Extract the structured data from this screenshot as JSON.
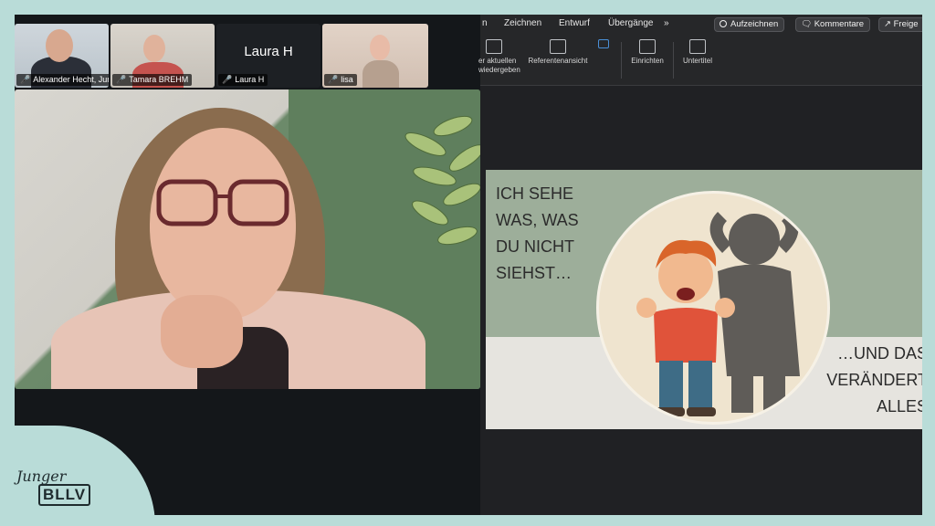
{
  "participants": [
    {
      "name": "Alexander Hecht, Jun..."
    },
    {
      "name": "Tamara BREHM"
    },
    {
      "name": "Laura H",
      "big_name": "Laura H"
    },
    {
      "name": "lisa"
    }
  ],
  "ppt": {
    "tabs": [
      "n",
      "Zeichnen",
      "Entwurf",
      "Übergänge",
      "»"
    ],
    "buttons": {
      "record": "Aufzeichnen",
      "comments": "Kommentare",
      "share": "Freige"
    },
    "ribbon": {
      "from_current_line1": "er aktuellen",
      "from_current_line2": "wiedergeben",
      "presenter_view": "Referentenansicht",
      "setup": "Einrichten",
      "subtitles": "Untertitel"
    },
    "slide": {
      "title_lines": [
        "ICH SEHE",
        "WAS, WAS",
        "DU NICHT",
        "SIEHST…"
      ],
      "subtitle_lines": [
        "…UND DAS",
        "VERÄNDERT",
        "ALLES"
      ]
    }
  },
  "logo": {
    "line1": "Junger",
    "line2": "BLLV"
  },
  "colors": {
    "background": "#b9dcd8",
    "slide_band": "#9dae9a",
    "mic_muted": "#e34b4b"
  }
}
